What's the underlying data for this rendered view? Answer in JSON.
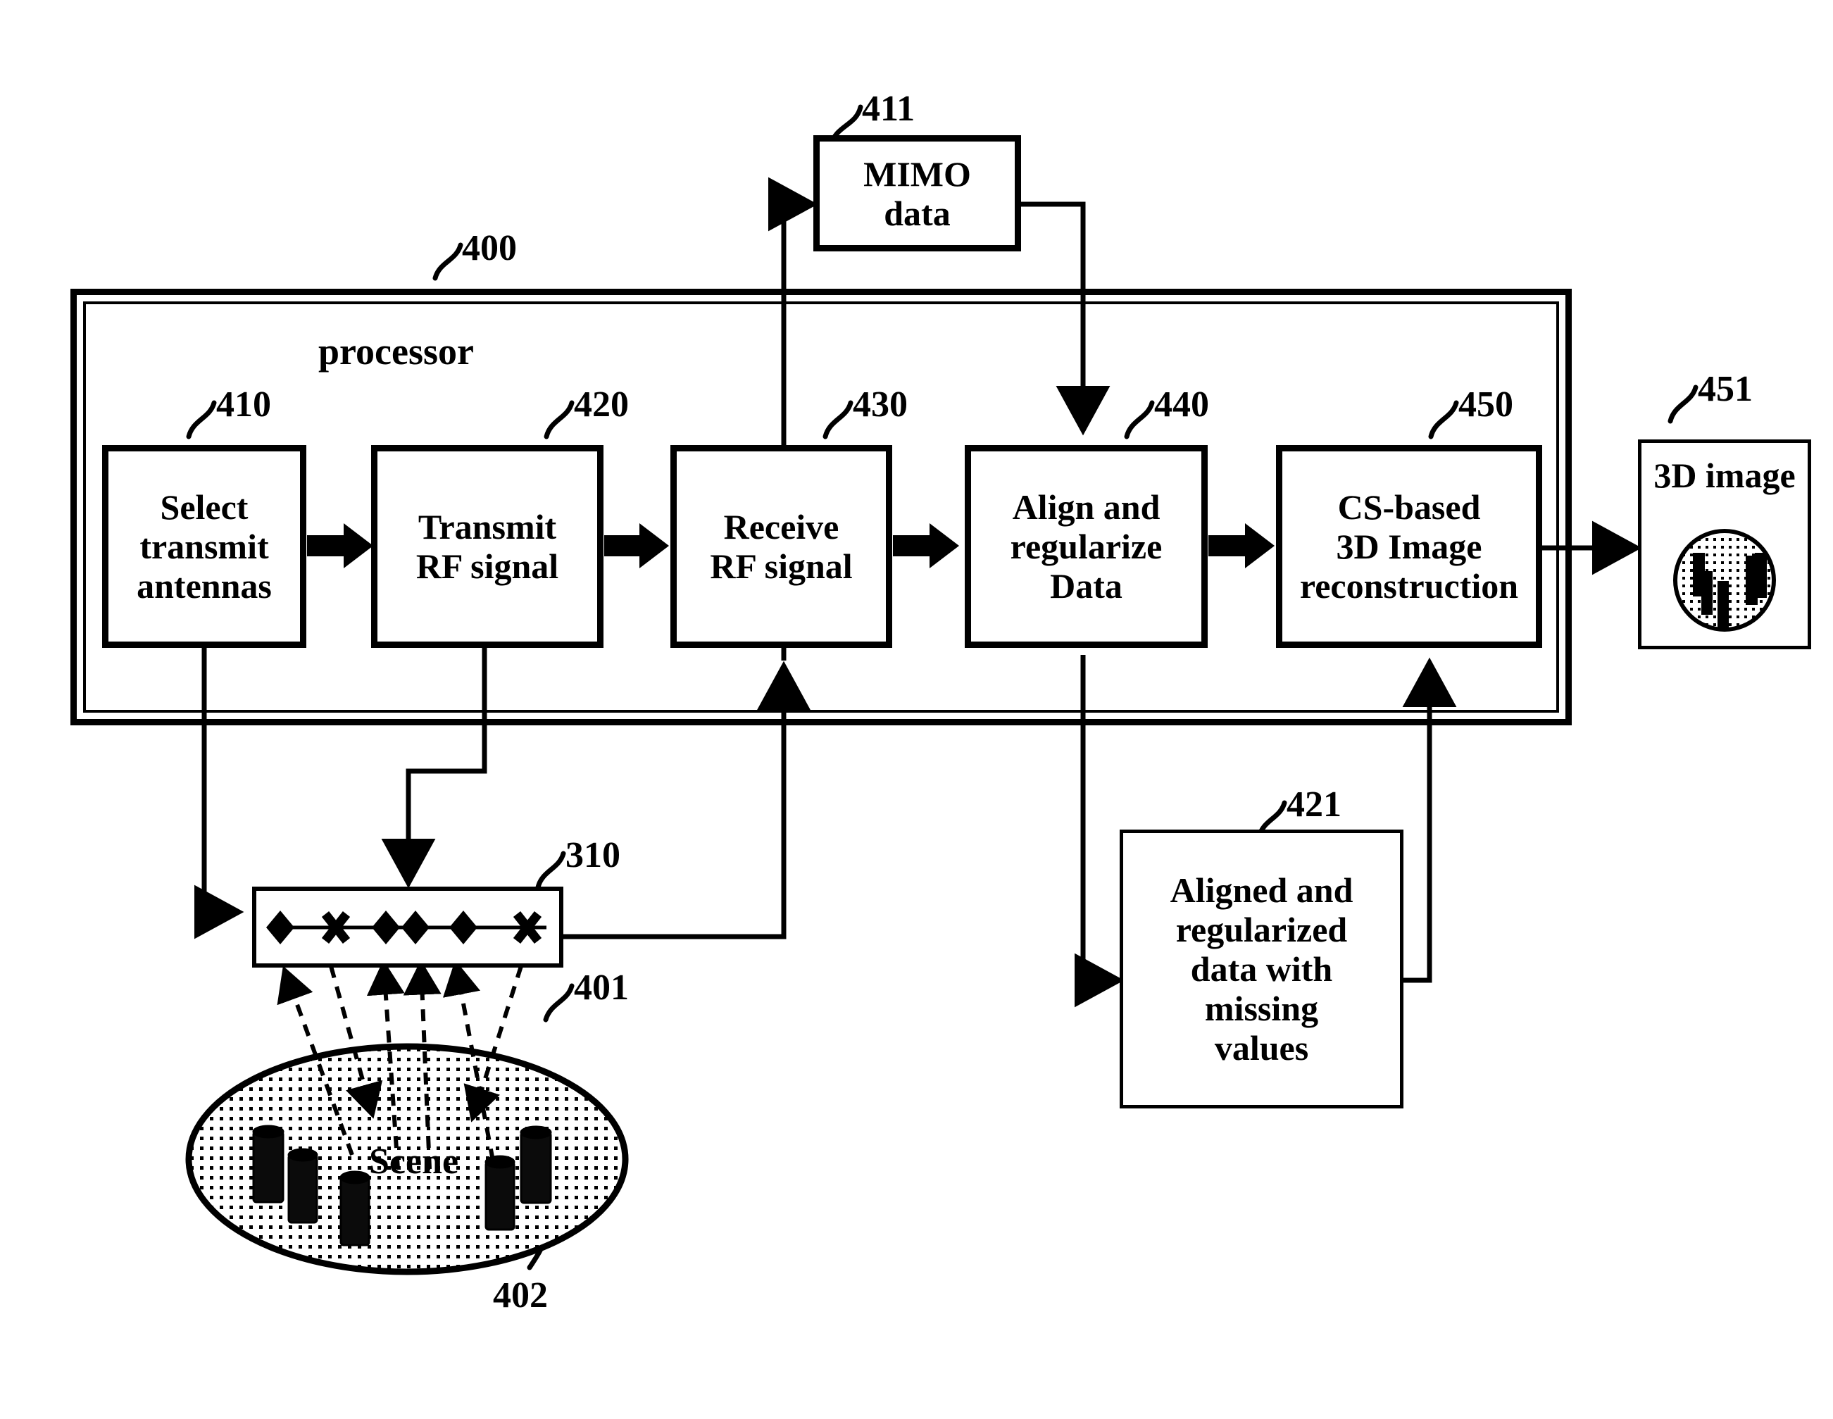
{
  "figure": {
    "title": "MIMO radar compressive-sensing 3D imaging block diagram",
    "processor_label": "processor",
    "scene_label": "Scene"
  },
  "reference_numerals": {
    "system": "400",
    "scene_ellipse": "401",
    "scene_objects": "402",
    "antenna_array": "310",
    "select_transmit_antennas": "410",
    "mimo_data": "411",
    "transmit_rf_signal": "420",
    "aligned_regularized_data": "421",
    "receive_rf_signal": "430",
    "align_and_regularize": "440",
    "cs_reconstruction": "450",
    "three_d_image": "451"
  },
  "blocks": [
    {
      "id": "select_antennas",
      "ref": "410",
      "lines": [
        "Select",
        "transmit",
        "antennas"
      ]
    },
    {
      "id": "transmit_rf",
      "ref": "420",
      "lines": [
        "Transmit",
        "RF signal"
      ]
    },
    {
      "id": "receive_rf",
      "ref": "430",
      "lines": [
        "Receive",
        "RF signal"
      ]
    },
    {
      "id": "align_regularize",
      "ref": "440",
      "lines": [
        "Align and",
        "regularize",
        "Data"
      ]
    },
    {
      "id": "cs_reconstruction",
      "ref": "450",
      "lines": [
        "CS-based",
        "3D Image",
        "reconstruction"
      ]
    },
    {
      "id": "mimo_data",
      "ref": "411",
      "lines": [
        "MIMO",
        "data"
      ]
    },
    {
      "id": "aligned_data",
      "ref": "421",
      "lines": [
        "Aligned and",
        "regularized",
        "data with",
        "missing",
        "values"
      ]
    },
    {
      "id": "three_d_image",
      "ref": "451",
      "lines": [
        "3D image"
      ]
    }
  ],
  "block_text": {
    "select_antennas": "Select\ntransmit\nantennas",
    "transmit_rf": "Transmit\nRF signal",
    "receive_rf": "Receive\nRF signal",
    "align_regularize": "Align and\nregularize\nData",
    "cs_reconstruction": "CS-based\n3D Image\nreconstruction",
    "mimo_data": "MIMO\ndata",
    "aligned_data": "Aligned and\nregularized\ndata with\nmissing\nvalues",
    "three_d_image": "3D image"
  },
  "antenna_array": {
    "ref": "310",
    "elements": [
      "diamond",
      "x",
      "diamond",
      "diamond",
      "diamond",
      "x"
    ],
    "element_meaning": {
      "diamond": "active / selected transmit antenna element",
      "x": "inactive / unselected antenna element"
    }
  },
  "scene": {
    "ref_ellipse": "401",
    "ref_objects": "402",
    "label": "Scene",
    "object_count": 5,
    "transmit_ray_count": 2,
    "receive_ray_count": 4
  },
  "three_d_image_panel": {
    "ref": "451",
    "caption": "3D image",
    "object_count": 5
  },
  "colors": {
    "ink": "#000000",
    "paper": "#ffffff"
  }
}
